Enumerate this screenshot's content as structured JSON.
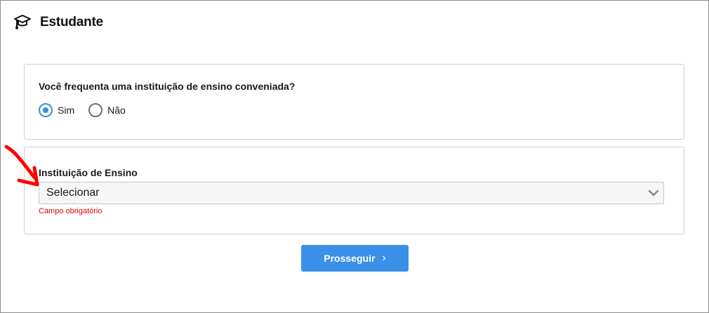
{
  "header": {
    "title": "Estudante",
    "icon": "graduation-cap-icon"
  },
  "question": {
    "text": "Você frequenta uma instituição de ensino conveniada?",
    "options": [
      {
        "label": "Sim",
        "checked": true
      },
      {
        "label": "Não",
        "checked": false
      }
    ]
  },
  "institution": {
    "label": "Instituição de Ensino",
    "selected": "Selecionar",
    "error": "Campo obrigatório"
  },
  "actions": {
    "continue_label": "Prosseguir",
    "continue_icon": "chevron-right-icon"
  },
  "colors": {
    "accent": "#3a8fe8",
    "error": "#e00000",
    "annotation": "#ff0000"
  }
}
